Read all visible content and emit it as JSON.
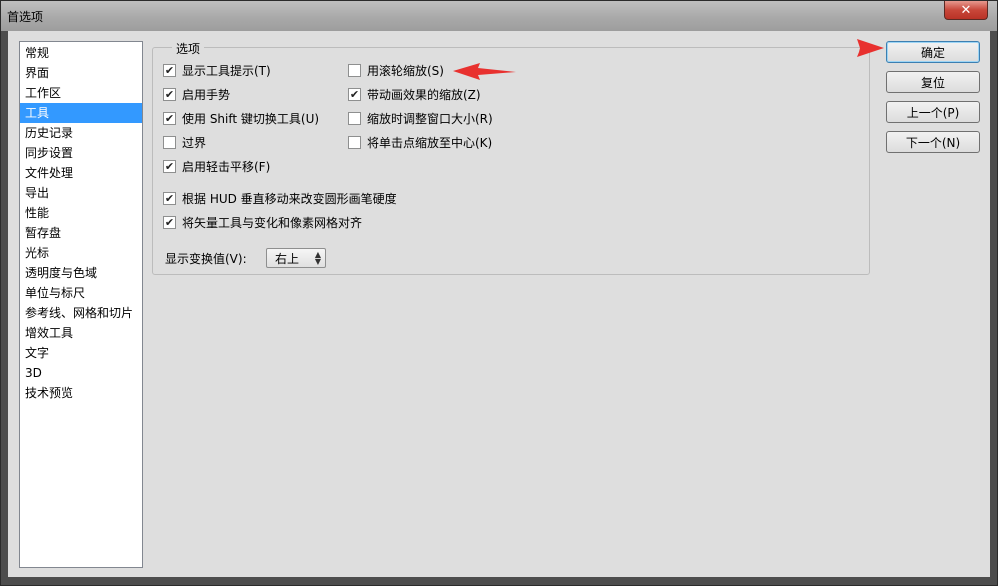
{
  "window": {
    "title": "首选项",
    "close_glyph": "✕"
  },
  "sidebar": {
    "items": [
      {
        "label": "常规"
      },
      {
        "label": "界面"
      },
      {
        "label": "工作区"
      },
      {
        "label": "工具",
        "selected": true
      },
      {
        "label": "历史记录"
      },
      {
        "label": "同步设置"
      },
      {
        "label": "文件处理"
      },
      {
        "label": "导出"
      },
      {
        "label": "性能"
      },
      {
        "label": "暂存盘"
      },
      {
        "label": "光标"
      },
      {
        "label": "透明度与色域"
      },
      {
        "label": "单位与标尺"
      },
      {
        "label": "参考线、网格和切片"
      },
      {
        "label": "增效工具"
      },
      {
        "label": "文字"
      },
      {
        "label": "3D"
      },
      {
        "label": "技术预览"
      }
    ]
  },
  "options_group": {
    "title": "选项",
    "checkboxes": [
      {
        "label": "显示工具提示(T)",
        "checked": true
      },
      {
        "label": "启用手势",
        "checked": true
      },
      {
        "label": "使用 Shift 键切换工具(U)",
        "checked": true
      },
      {
        "label": "过界",
        "checked": false
      },
      {
        "label": "启用轻击平移(F)",
        "checked": true
      },
      {
        "label": "用滚轮缩放(S)",
        "checked": false
      },
      {
        "label": "带动画效果的缩放(Z)",
        "checked": true
      },
      {
        "label": "缩放时调整窗口大小(R)",
        "checked": false
      },
      {
        "label": "将单击点缩放至中心(K)",
        "checked": false
      },
      {
        "label": "根据 HUD 垂直移动来改变圆形画笔硬度",
        "checked": true
      },
      {
        "label": "将矢量工具与变化和像素网格对齐",
        "checked": true
      }
    ],
    "transform_value": {
      "label": "显示变换值(V):",
      "selected": "右上"
    }
  },
  "buttons": {
    "ok": "确定",
    "reset": "复位",
    "prev": "上一个(P)",
    "next": "下一个(N)"
  },
  "colors": {
    "selection": "#3399ff",
    "annotation_arrow": "#e8312f",
    "dialog_bg": "#dedede"
  }
}
